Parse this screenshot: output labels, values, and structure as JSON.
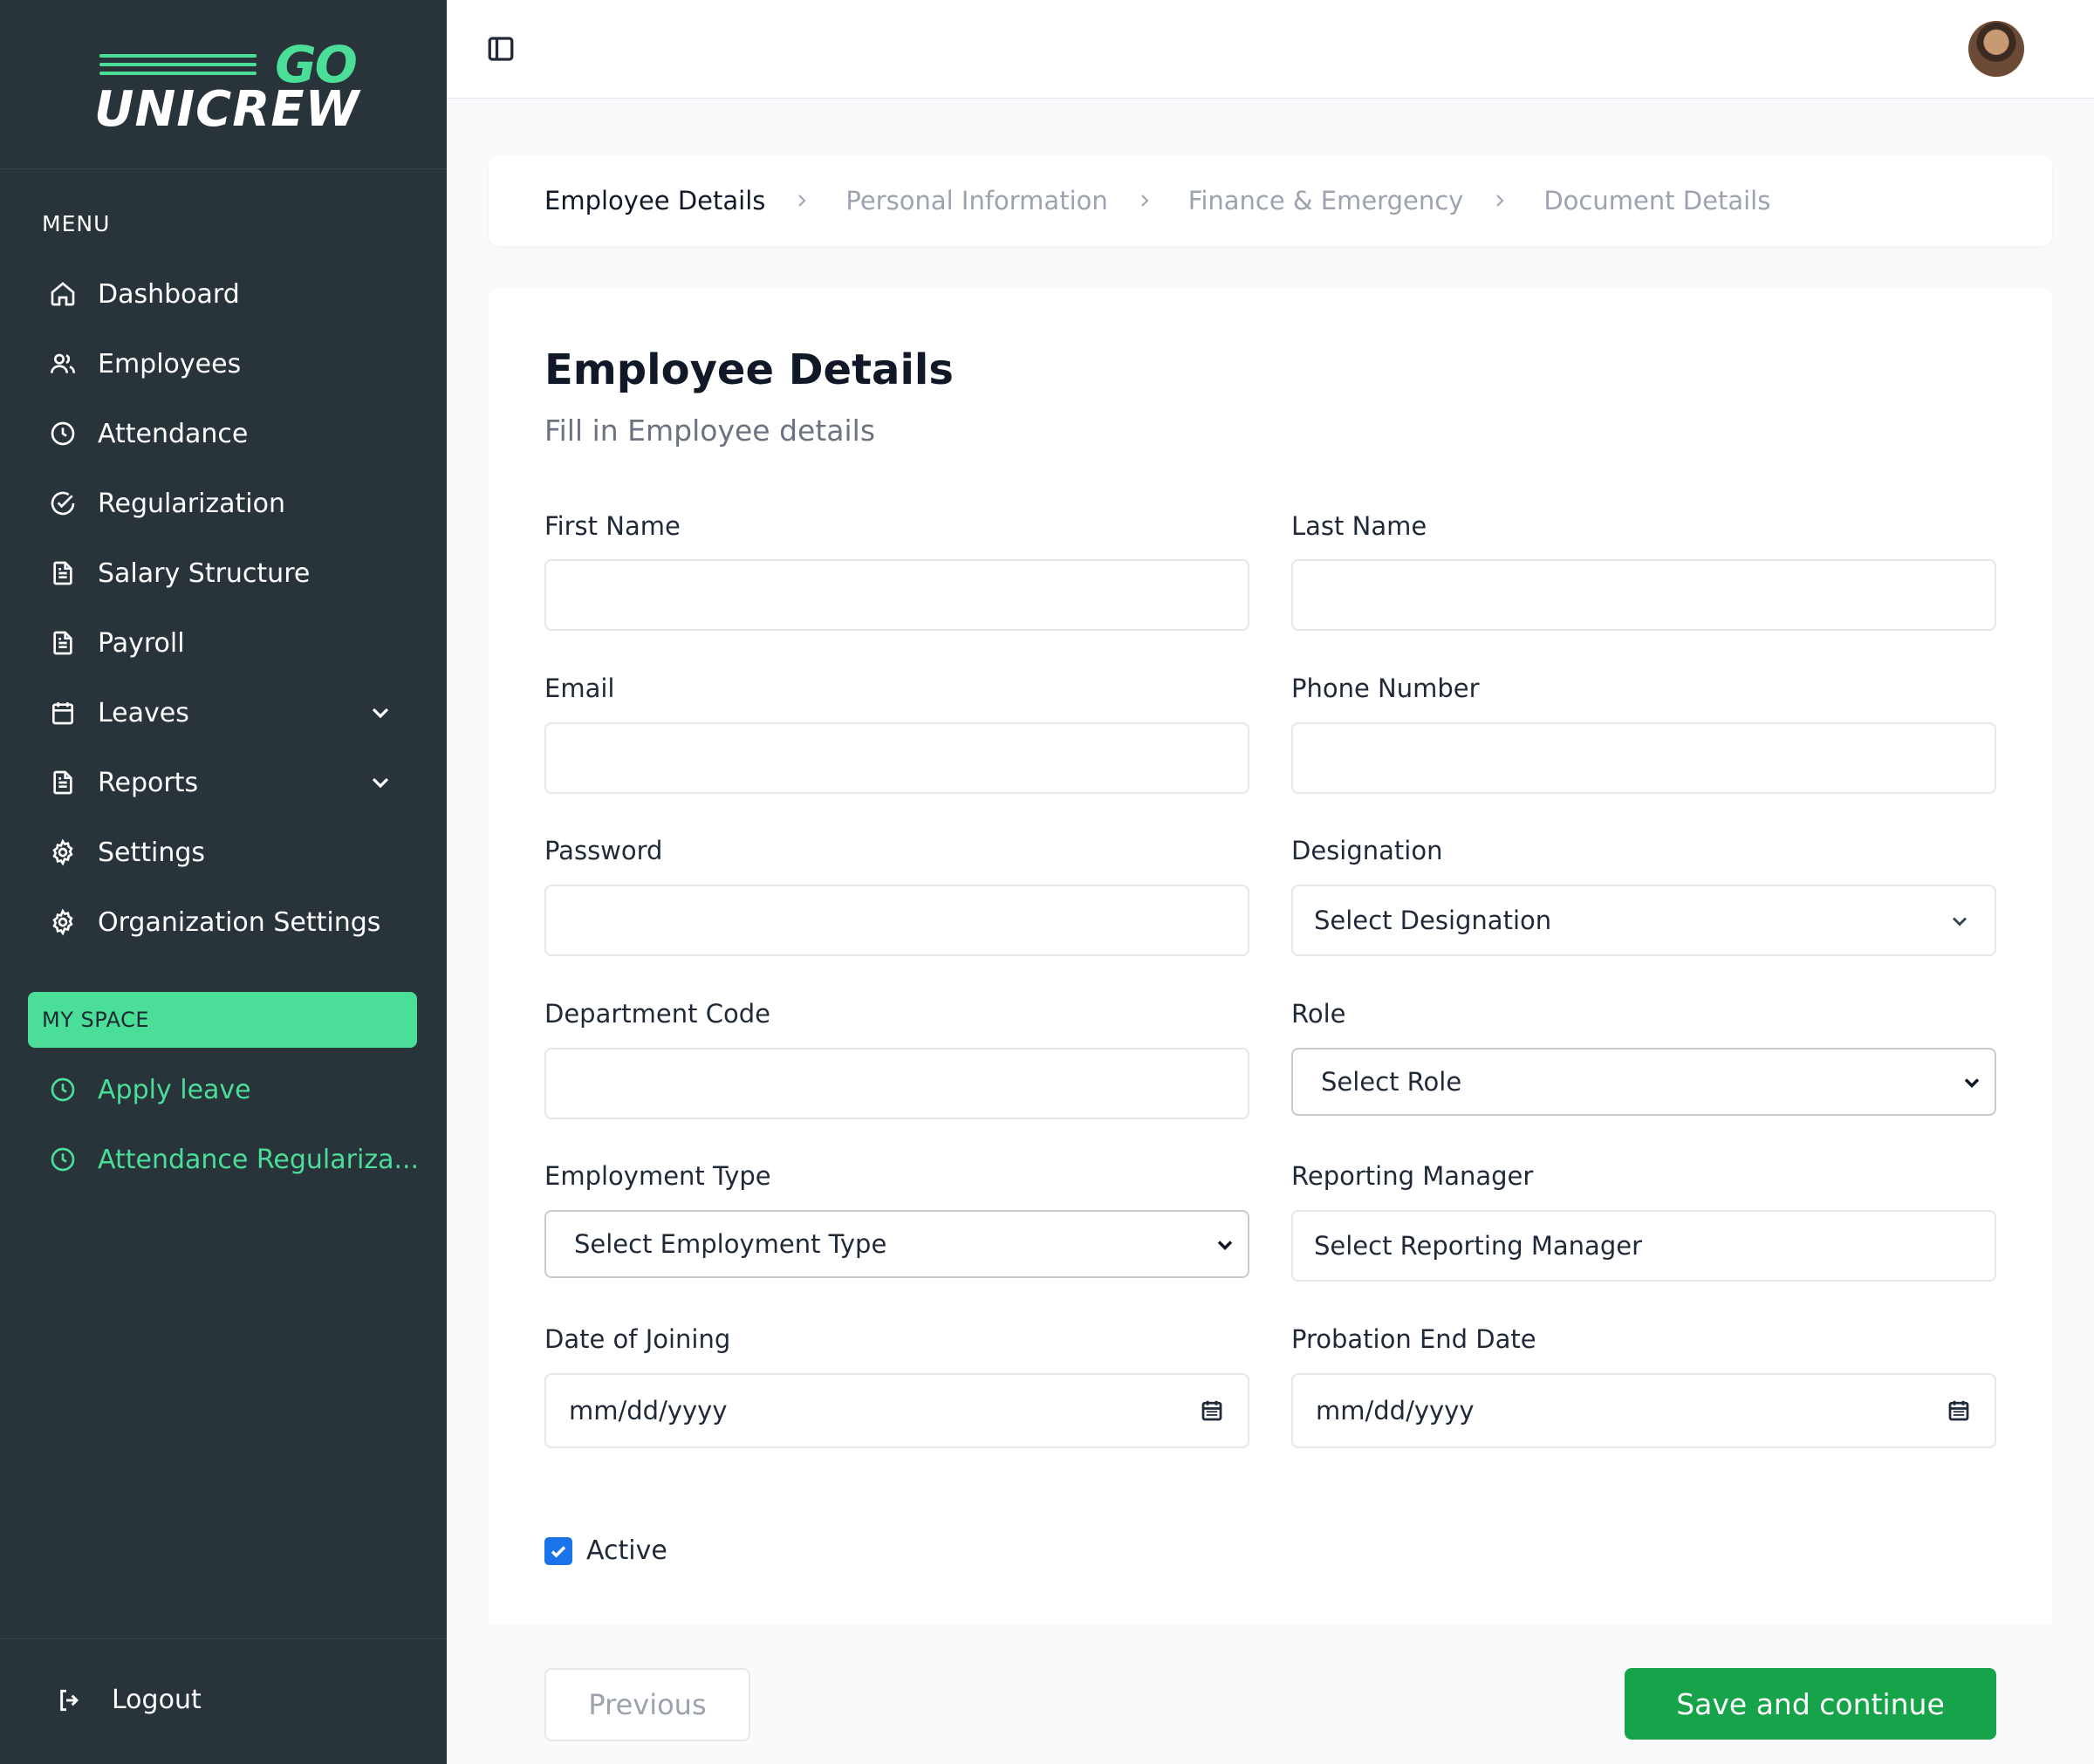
{
  "brand": {
    "logo_top": "GO",
    "logo_bottom": "UNICREW",
    "accent_color": "#4ade99",
    "sidebar_color": "#28333a"
  },
  "sidebar": {
    "menu_title": "MENU",
    "items": [
      {
        "label": "Dashboard",
        "icon": "home-icon"
      },
      {
        "label": "Employees",
        "icon": "users-icon"
      },
      {
        "label": "Attendance",
        "icon": "clock-icon"
      },
      {
        "label": "Regularization",
        "icon": "check-circle-icon"
      },
      {
        "label": "Salary Structure",
        "icon": "document-icon"
      },
      {
        "label": "Payroll",
        "icon": "document-icon"
      },
      {
        "label": "Leaves",
        "icon": "calendar-icon",
        "expandable": true
      },
      {
        "label": "Reports",
        "icon": "document-icon",
        "expandable": true
      },
      {
        "label": "Settings",
        "icon": "gear-icon"
      },
      {
        "label": "Organization Settings",
        "icon": "gear-icon"
      }
    ],
    "my_space_title": "MY SPACE",
    "my_space_items": [
      {
        "label": "Apply leave",
        "icon": "clock-icon"
      },
      {
        "label": "Attendance Regulariza...",
        "icon": "clock-icon"
      }
    ],
    "logout_label": "Logout"
  },
  "stepper": {
    "steps": [
      "Employee Details",
      "Personal Information",
      "Finance & Emergency",
      "Document Details"
    ],
    "active_index": 0
  },
  "form": {
    "title": "Employee Details",
    "subtitle": "Fill in Employee details",
    "fields": {
      "first_name": {
        "label": "First Name",
        "value": ""
      },
      "last_name": {
        "label": "Last Name",
        "value": ""
      },
      "email": {
        "label": "Email",
        "value": ""
      },
      "phone": {
        "label": "Phone Number",
        "value": ""
      },
      "password": {
        "label": "Password",
        "value": ""
      },
      "designation": {
        "label": "Designation",
        "value": "Select Designation"
      },
      "department_code": {
        "label": "Department Code",
        "value": ""
      },
      "role": {
        "label": "Role",
        "value": "Select Role"
      },
      "employment_type": {
        "label": "Employment Type",
        "value": "Select Employment Type"
      },
      "reporting_manager": {
        "label": "Reporting Manager",
        "value": "Select Reporting Manager"
      },
      "date_of_joining": {
        "label": "Date of Joining",
        "placeholder": "mm/dd/yyyy"
      },
      "probation_end": {
        "label": "Probation End Date",
        "placeholder": "mm/dd/yyyy"
      }
    },
    "active": {
      "label": "Active",
      "checked": true
    }
  },
  "actions": {
    "previous_label": "Previous",
    "save_label": "Save and continue",
    "save_color": "#16a34a"
  }
}
